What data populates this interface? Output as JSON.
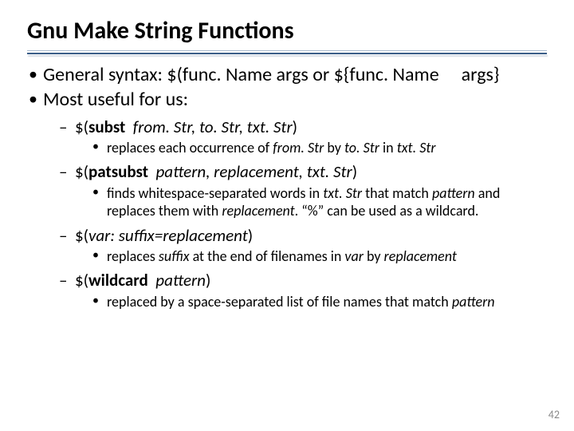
{
  "title": "Gnu Make String Functions",
  "bullets": {
    "b1_pre": "General syntax:  ",
    "b1_code1": "$(func. Name args",
    "b1_or": "  or  ",
    "b1_code2": "${func. Name",
    "b1_args": "args}",
    "b2": "Most useful for us:"
  },
  "fn": {
    "subst": {
      "head_open": "$(",
      "head_name": "subst",
      "head_args": "from. Str, to. Str, txt. Str",
      "head_close": ")",
      "desc_a": "replaces each occurrence of ",
      "desc_i1": "from. Str ",
      "desc_b": "by ",
      "desc_i2": "to. Str ",
      "desc_c": "in ",
      "desc_i3": "txt. Str"
    },
    "patsubst": {
      "head_open": "$(",
      "head_name": "patsubst",
      "head_args": "pattern, replacement, txt. Str",
      "head_close": ")",
      "desc_a": "finds whitespace-separated words in ",
      "desc_i1": "txt. Str ",
      "desc_b": "that match ",
      "desc_i2": "pattern ",
      "desc_c": "and replaces them with ",
      "desc_i3": "replacement",
      "desc_d": ".  “%” can be used as a wildcard."
    },
    "varsub": {
      "head_open": "$(",
      "head_i": "var: suffix=replacement",
      "head_close": ")",
      "desc_a": "replaces ",
      "desc_i1": "suffix ",
      "desc_b": "at the end of filenames in ",
      "desc_i2": "var ",
      "desc_c": "by ",
      "desc_i3": "replacement"
    },
    "wildcard": {
      "head_open": "$(",
      "head_name": "wildcard",
      "head_args": "pattern",
      "head_close": ")",
      "desc_a": "replaced by a space-separated list of file names that match ",
      "desc_i1": "pattern"
    }
  },
  "page_number": "42"
}
